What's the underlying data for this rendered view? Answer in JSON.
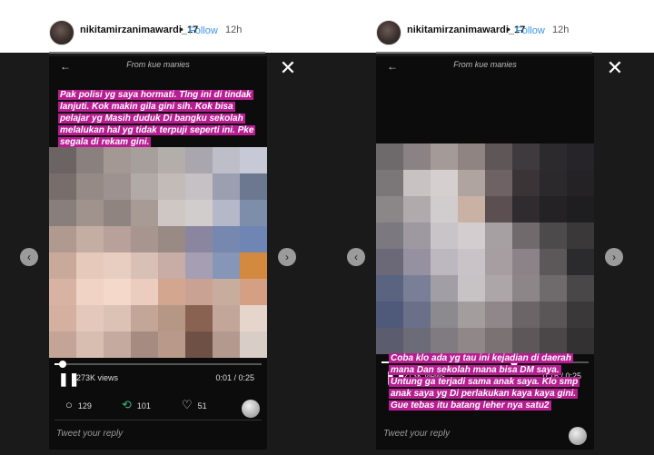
{
  "stories": [
    {
      "user": {
        "username": "nikitamirzanimawardi_17",
        "follow_label": "Follow",
        "time": "12h",
        "dot": "•"
      },
      "header": {
        "back": "←",
        "from_label": "From kue manies"
      },
      "caption": "Pak polisi yg saya hormati. Tlng ini di tindak lanjuti. Kok makin gila gini sih. Kok bisa pelajar yg Masih duduk Di bangku sekolah melalukan hal yg tidak terpuji seperti ini. Pke segala di rekam gini.",
      "player": {
        "views": "273K views",
        "time": "0:01 / 0:25",
        "progress": 0.04,
        "pause_icon": "❚❚"
      },
      "actions": {
        "replies": "129",
        "retweets": "101",
        "likes": "51"
      },
      "reply_placeholder": "Tweet your reply",
      "mosaic_colors": [
        "#6c6462",
        "#8a807d",
        "#a39894",
        "#a69f9b",
        "#b4aeab",
        "#aaa6ae",
        "#bdbec7",
        "#c8c9d6",
        "#776e6c",
        "#958a86",
        "#9d928f",
        "#b2aaa6",
        "#c2bbb7",
        "#c5c1c4",
        "#9b9fb0",
        "#6b7890",
        "#887f7c",
        "#a0938e",
        "#8f847f",
        "#a89a95",
        "#cfc7c4",
        "#d2cdcd",
        "#b4b8c8",
        "#7d8eaa",
        "#b09a90",
        "#c4aea3",
        "#b7a19a",
        "#a8958f",
        "#9a8a86",
        "#8b86a0",
        "#7688b0",
        "#6f86b5",
        "#c9a99a",
        "#e6c9bb",
        "#e7cec1",
        "#d8c0b6",
        "#c7ada5",
        "#a69fb3",
        "#8596b6",
        "#d48a3e",
        "#d8b3a3",
        "#f1d3c6",
        "#f4d8ca",
        "#eacdbf",
        "#d3a78f",
        "#c9a293",
        "#c8ad9f",
        "#d49f82",
        "#d3b0a0",
        "#e4c8bb",
        "#dcc1b5",
        "#c3a697",
        "#b69685",
        "#8a6252",
        "#c2a699",
        "#e5d5cb",
        "#c4a496",
        "#d8bdb1",
        "#c5aaa0",
        "#a58b80",
        "#b9998a",
        "#6f5044",
        "#b49a8e",
        "#d8cdc7"
      ]
    },
    {
      "user": {
        "username": "nikitamirzanimawardi_17",
        "follow_label": "Follow",
        "time": "12h",
        "dot": "•"
      },
      "header": {
        "back": "←",
        "from_label": "From kue manies"
      },
      "caption": "Coba klo ada yg tau ini kejadian di daerah mana Dan sekolah mana bisa DM saya. Untung ga terjadi sama anak saya. Klo smp anak saya yg Di perlakukan kaya kaya gini. Gue tebas itu batang leher nya satu2",
      "player": {
        "views": "273K views",
        "time": "0:16 / 0:25",
        "progress": 0.64,
        "pause_icon": "❚❚"
      },
      "reply_placeholder": "Tweet your reply",
      "mosaic_colors": [
        "#6e6a6c",
        "#8a8284",
        "#a49a98",
        "#8f8482",
        "#5f5658",
        "#3f3a3d",
        "#2c2a2d",
        "#262428",
        "#7b7678",
        "#c9c2c2",
        "#d5cfcf",
        "#b0a4a0",
        "#6f6264",
        "#3b3436",
        "#2b292b",
        "#242225",
        "#8b8688",
        "#b1aaac",
        "#d1cccd",
        "#c9b1a4",
        "#5b4f52",
        "#2f2b2e",
        "#242225",
        "#1e1d20",
        "#7c7880",
        "#9e99a0",
        "#c8c4c7",
        "#d3cdd0",
        "#a7a0a3",
        "#716a6d",
        "#4d4a4c",
        "#3a3839",
        "#6b6878",
        "#9591a0",
        "#bdb8c0",
        "#c9c3c8",
        "#a69ea1",
        "#8b8387",
        "#5c5859",
        "#2b2a2c",
        "#5a6380",
        "#7a7f98",
        "#a19ea6",
        "#c7c2c4",
        "#ada6a9",
        "#8d8689",
        "#6f6a6b",
        "#4a4748",
        "#4f5a7a",
        "#6b7089",
        "#8d8a8f",
        "#a49d9e",
        "#8f8789",
        "#6c6567",
        "#5a5556",
        "#3a3839",
        "#5b5c6e",
        "#6c6b78",
        "#7f7b80",
        "#8f8788",
        "#7b7274",
        "#5e5759",
        "#4b4647",
        "#333132"
      ]
    }
  ]
}
